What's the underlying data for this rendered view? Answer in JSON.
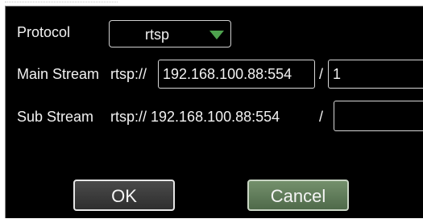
{
  "protocol": {
    "label": "Protocol",
    "selected": "rtsp"
  },
  "main_stream": {
    "label": "Main Stream",
    "prefix": "rtsp://",
    "host": "192.168.100.88:554",
    "separator": "/",
    "path": "1"
  },
  "sub_stream": {
    "label": "Sub Stream",
    "url": "rtsp:// 192.168.100.88:554",
    "separator": "/",
    "path": ""
  },
  "buttons": {
    "ok": "OK",
    "cancel": "Cancel"
  },
  "colors": {
    "background": "#000000",
    "arrow": "#4ea24e",
    "cancel_button": "#5f7a59"
  }
}
